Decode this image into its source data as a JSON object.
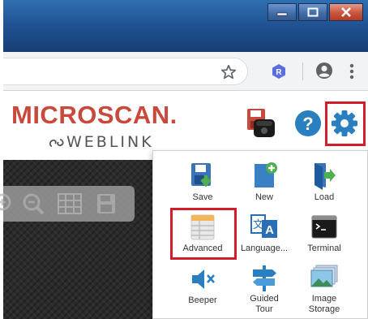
{
  "window": {
    "controls": [
      "minimize",
      "maximize",
      "close"
    ]
  },
  "browser": {
    "icons": [
      "bookmark-star-icon",
      "extension-icon",
      "profile-icon",
      "menu-icon"
    ],
    "extension_letter": "R"
  },
  "app": {
    "brand": {
      "name": "MICROSCAN.",
      "product": "WEBLINK"
    },
    "header_icons": [
      "save-reader-icon",
      "help-icon",
      "settings-icon"
    ],
    "zoom_toolbar": [
      "zoom-in-icon",
      "zoom-out-icon",
      "grid-icon",
      "save-image-icon"
    ]
  },
  "menu": {
    "items": [
      {
        "label": "Save",
        "icon": "save-icon"
      },
      {
        "label": "New",
        "icon": "new-file-icon"
      },
      {
        "label": "Load",
        "icon": "load-icon"
      },
      {
        "label": "Advanced",
        "icon": "advanced-table-icon"
      },
      {
        "label": "Language...",
        "icon": "language-icon"
      },
      {
        "label": "Terminal",
        "icon": "terminal-icon"
      },
      {
        "label": "Beeper",
        "icon": "beeper-icon"
      },
      {
        "label": "Guided\nTour",
        "icon": "guided-tour-icon"
      },
      {
        "label": "Image\nStorage",
        "icon": "image-storage-icon"
      }
    ]
  },
  "highlight_color": "#d01f2a",
  "accent_colors": {
    "brand": "#c94a3c",
    "icon_blue": "#2a7fc1"
  }
}
